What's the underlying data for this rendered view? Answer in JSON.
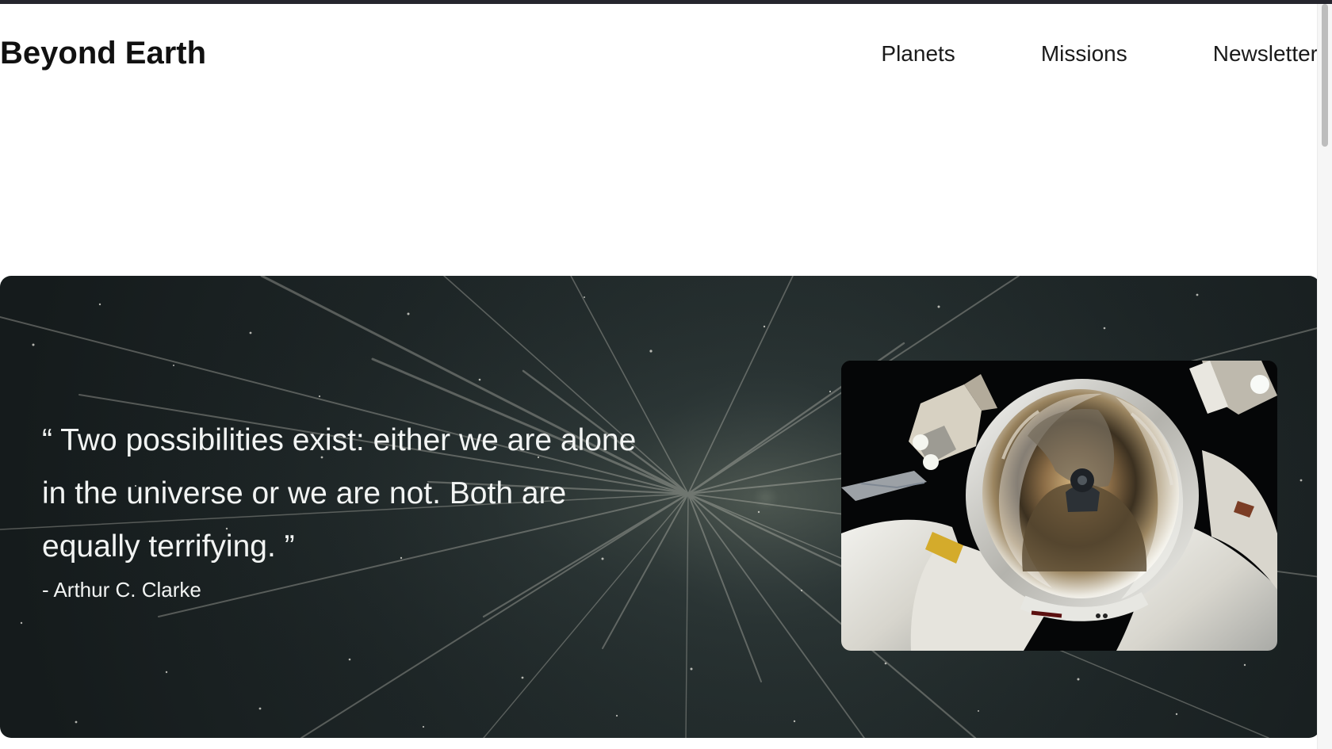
{
  "header": {
    "brand": "Beyond Earth",
    "nav": [
      {
        "label": "Planets"
      },
      {
        "label": "Missions"
      },
      {
        "label": "Newsletter"
      }
    ]
  },
  "hero": {
    "quote": "“ Two possibilities exist: either we are alone in the universe or we are not. Both are equally terrifying. ”",
    "author": "- Arthur C. Clarke"
  }
}
